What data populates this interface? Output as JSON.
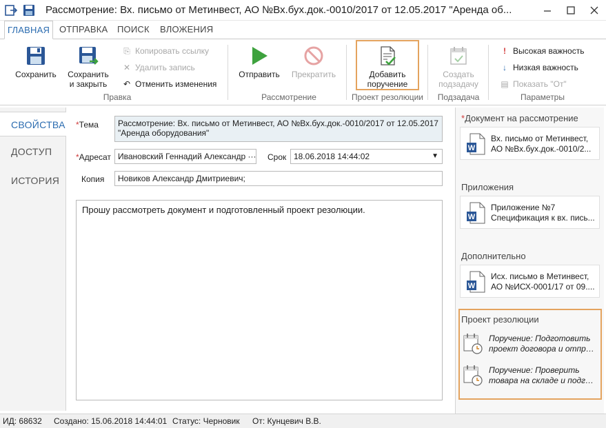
{
  "window": {
    "title": "Рассмотрение: Вх. письмо от Метинвест, АО №Вх.бух.док.-0010/2017 от 12.05.2017 \"Аренда об...",
    "icons": [
      "window-arrow-icon",
      "save-icon",
      "minimize-icon",
      "maximize-icon",
      "close-icon"
    ]
  },
  "tabs": [
    "ГЛАВНАЯ",
    "ОТПРАВКА",
    "ПОИСК",
    "ВЛОЖЕНИЯ"
  ],
  "ribbon": {
    "groups": {
      "edit": "Правка",
      "review": "Рассмотрение",
      "project": "Проект резолюции",
      "subtask": "Подзадача",
      "params": "Параметры"
    },
    "save": "Сохранить",
    "save_close_1": "Сохранить",
    "save_close_2": "и закрыть",
    "copy_link": "Копировать ссылку",
    "delete_record": "Удалить запись",
    "undo_changes": "Отменить изменения",
    "send": "Отправить",
    "stop": "Прекратить",
    "add_task_1": "Добавить",
    "add_task_2": "поручение",
    "create_sub_1": "Создать",
    "create_sub_2": "подзадачу",
    "high_importance": "Высокая важность",
    "low_importance": "Низкая важность",
    "show_from": "Показать \"От\""
  },
  "nav": [
    "СВОЙСТВА",
    "ДОСТУП",
    "ИСТОРИЯ"
  ],
  "form": {
    "subject_label": "Тема",
    "subject_value_1": "Рассмотрение: Вх. письмо от Метинвест, АО №Вх.бух.док.-0010/2017 от 12.05.2017",
    "subject_value_2": "\"Аренда оборудования\"",
    "addressee_label": "Адресат",
    "addressee_value": "Ивановский Геннадий Александр ···",
    "due_label": "Срок",
    "due_value": "18.06.2018 14:44:02",
    "copy_label": "Копия",
    "copy_value": "Новиков Александр Дмитриевич;",
    "body": "Прошу рассмотреть документ и подготовленный проект резолюции.",
    "required_mark": "*"
  },
  "right_panel": {
    "doc_title": "Документ на рассмотрение",
    "doc_lines": [
      "Вх. письмо от Метинвест,",
      "АО №Вх.бух.док.-0010/2..."
    ],
    "attach_title": "Приложения",
    "attach_lines": [
      "Приложение №7",
      "Спецификация к вх. пись..."
    ],
    "extra_title": "Дополнительно",
    "extra_lines": [
      "Исх. письмо в Метинвест,",
      "АО №ИСХ-0001/17 от 09...."
    ],
    "project_title": "Проект резолюции",
    "task1_lines": [
      "Поручение: Подготовить",
      "проект договора и отпра..."
    ],
    "task2_lines": [
      "Поручение: Проверить",
      "товара на складе и подгот..."
    ]
  },
  "status": {
    "id": "ИД: 68632",
    "created": "Создано: 15.06.2018 14:44:01",
    "state": "Статус: Черновик",
    "from": "От: Кунцевич В.В."
  },
  "colors": {
    "accent": "#2b6cb0",
    "highlight": "#e4a35e",
    "send_green": "#3ea23e",
    "word_blue": "#2b5797"
  }
}
